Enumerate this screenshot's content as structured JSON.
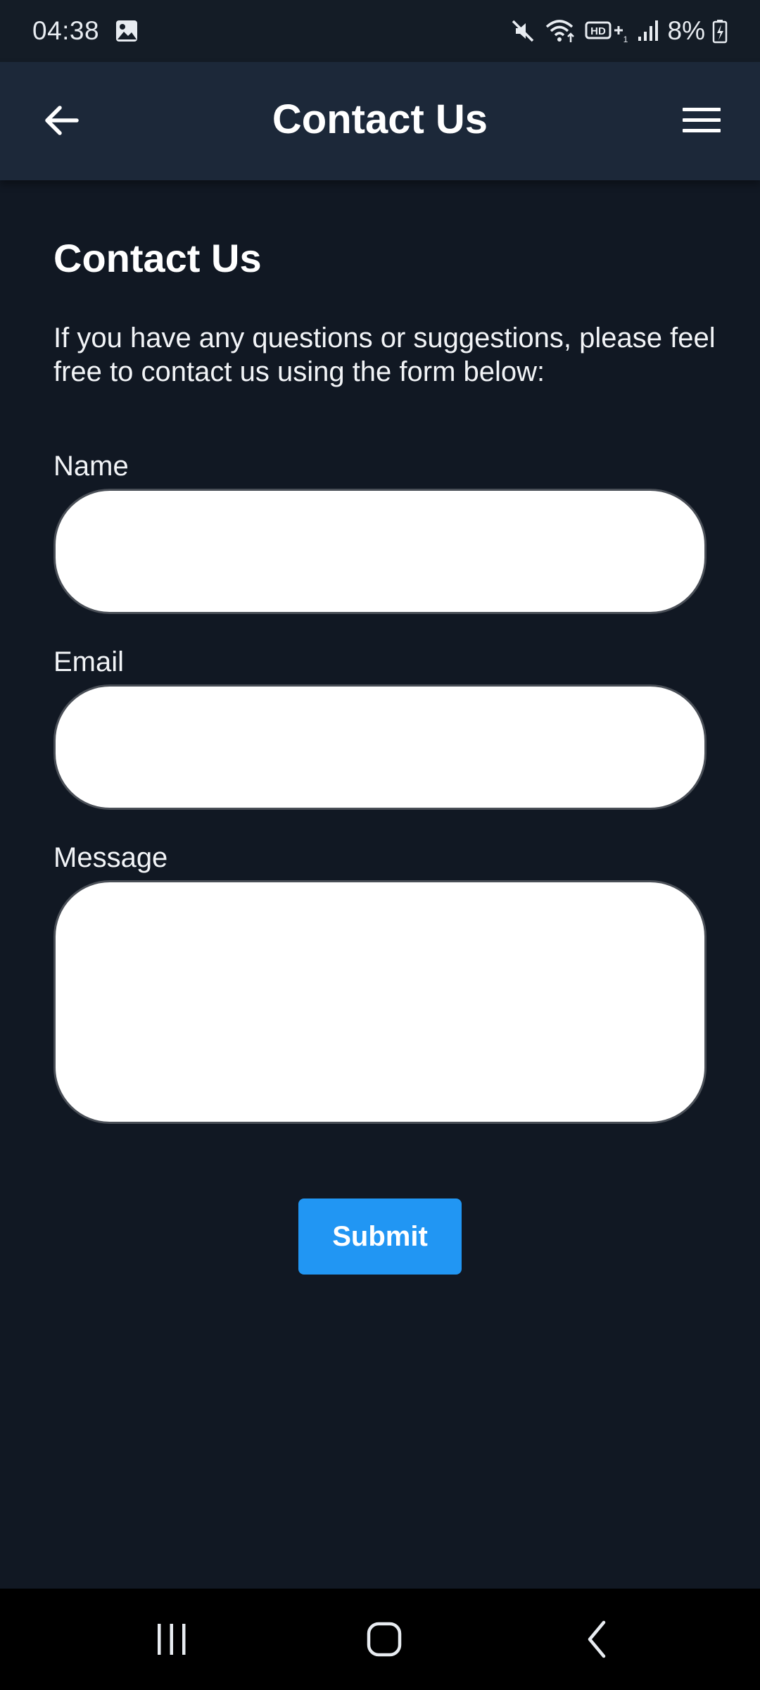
{
  "status_bar": {
    "time": "04:38",
    "battery_percent": "8%",
    "icons": [
      "gallery-notification-icon",
      "mute-icon",
      "wifi-icon",
      "hd-voice-icon",
      "signal-icon",
      "battery-charging-icon"
    ]
  },
  "app_bar": {
    "title": "Contact Us",
    "back_icon": "arrow-left-icon",
    "menu_icon": "hamburger-menu-icon"
  },
  "page": {
    "heading": "Contact Us",
    "intro": "If you have any questions or suggestions, please feel free to contact us using the form below:"
  },
  "form": {
    "name_label": "Name",
    "name_value": "",
    "email_label": "Email",
    "email_value": "",
    "message_label": "Message",
    "message_value": "",
    "submit_label": "Submit"
  },
  "nav_bar": {
    "icons": [
      "recent-apps-icon",
      "home-icon",
      "back-icon"
    ]
  },
  "colors": {
    "background": "#111823",
    "app_bar": "#1c2839",
    "accent": "#2196f3",
    "input_background": "#ffffff"
  }
}
